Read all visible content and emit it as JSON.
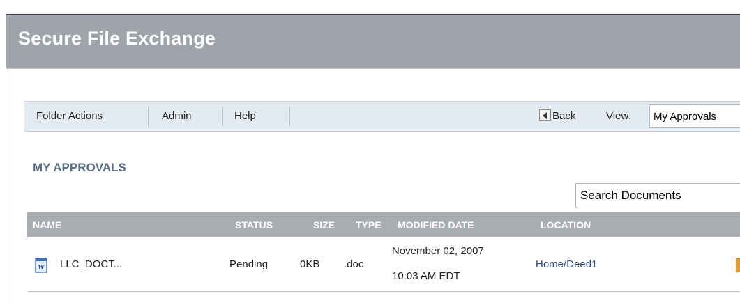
{
  "app": {
    "title": "Secure File Exchange"
  },
  "menubar": {
    "items": [
      {
        "label": "Folder Actions"
      },
      {
        "label": "Admin"
      },
      {
        "label": "Help"
      }
    ],
    "back_label": "Back",
    "view_label": "View:",
    "view_selected": "My Approvals"
  },
  "page": {
    "heading": "MY APPROVALS"
  },
  "search": {
    "value": "Search Documents"
  },
  "table": {
    "columns": [
      "NAME",
      "STATUS",
      "SIZE",
      "TYPE",
      "MODIFIED DATE",
      "LOCATION"
    ],
    "rows": [
      {
        "icon": "word-document-icon",
        "name": "LLC_DOCT...",
        "status": "Pending",
        "size": "0KB",
        "type": ".doc",
        "modified_date": "November 02, 2007",
        "modified_time": "10:03 AM EDT",
        "location": "Home/Deed1"
      }
    ]
  },
  "colors": {
    "title_bar": "#9ea4aa",
    "menubar": "#e4ebf3",
    "heading": "#5a6e88",
    "table_header": "#a9adb1",
    "link": "#2c4f8c",
    "action_icon": "#e59a2a"
  }
}
